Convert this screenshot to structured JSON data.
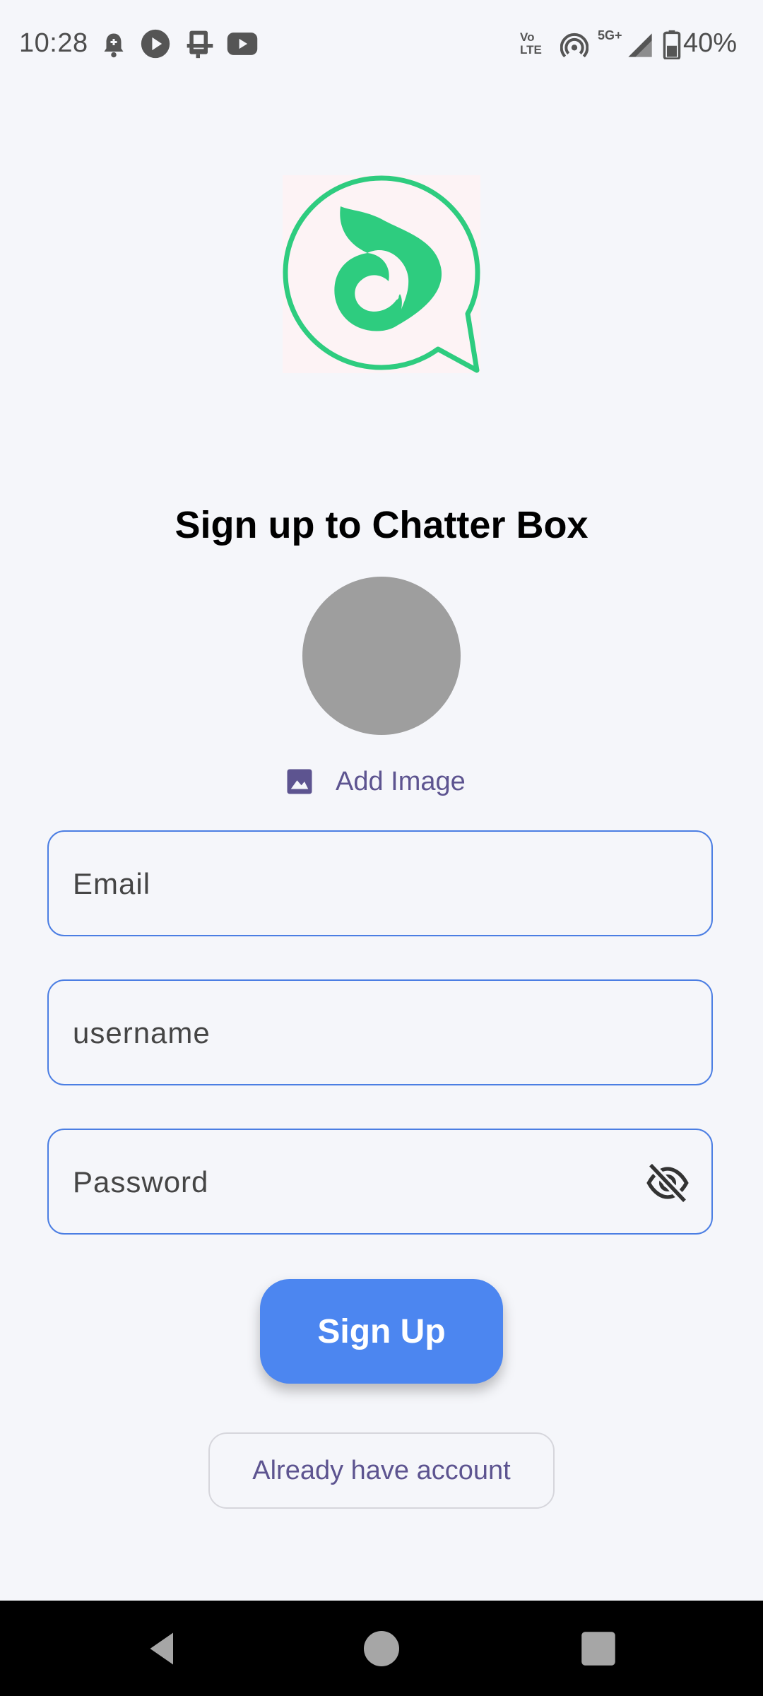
{
  "status_bar": {
    "time": "10:28",
    "network_type": "5G+",
    "volte_label": "Vo\nLTE",
    "battery_percent": "40%",
    "icons": [
      "alarm-icon",
      "play-icon",
      "device-icon",
      "youtube-icon",
      "volte-icon",
      "hotspot-icon",
      "signal-icon",
      "battery-icon"
    ]
  },
  "app": {
    "logo_colors": {
      "brand_green": "#2ecc7f",
      "background": "#fdf3f5"
    },
    "title": "Sign up to Chatter Box",
    "add_image_label": "Add Image",
    "email_placeholder": "Email",
    "username_placeholder": "username",
    "password_placeholder": "Password",
    "signup_label": "Sign Up",
    "login_label": "Already have account"
  },
  "colors": {
    "accent_blue": "#4c86f0",
    "field_border": "#4b7ee3",
    "link_purple": "#5d5490",
    "avatar_grey": "#9e9e9e"
  },
  "nav_bar": {
    "buttons": [
      "back-icon",
      "home-icon",
      "recents-icon"
    ]
  }
}
